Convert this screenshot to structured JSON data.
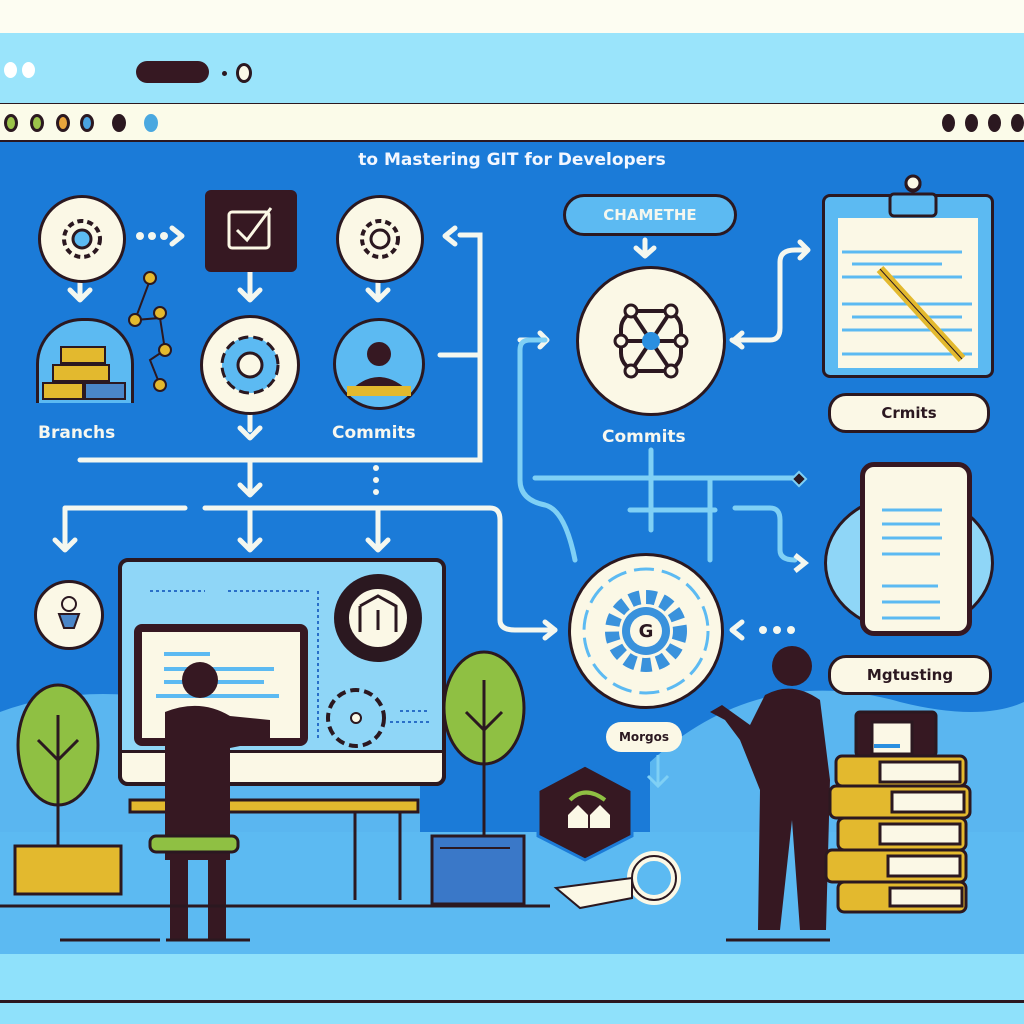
{
  "window": {
    "title": "to Mastering GIT  for Developers",
    "tab_dots_left": [
      "#9bc34a",
      "#9bc34a",
      "#e8a43c",
      "#4aa3e0",
      "#2b1820",
      "#4aa8e0"
    ],
    "tab_dots_right": 4
  },
  "colors": {
    "canvas_blue": "#1b7bd8",
    "light_blue": "#9ae4fb",
    "cream": "#fbf8e6",
    "dark": "#2b1820",
    "yellow": "#e3b92e",
    "green": "#8fc043"
  },
  "diagram": {
    "labels": {
      "branches": "Branchs",
      "commits_left": "Commits",
      "commits_center": "Commits",
      "top_pill": "CHAMETHE",
      "clipboard_pill": "Crmits",
      "phone_pill": "Mgtusting",
      "merge_pill": "Morgos",
      "merge_gear_letter": "G"
    },
    "icons": [
      "gear-icon",
      "checkbox-icon",
      "gear-icon",
      "branch-boxes-icon",
      "gear-icon",
      "developer-avatar-icon",
      "network-graph-icon",
      "clipboard-icon",
      "phone-icon",
      "merge-gear-icon",
      "person-icon",
      "monitor-icon",
      "hexagon-badge-icon",
      "key-icon",
      "books-icon",
      "tree-icon"
    ]
  }
}
